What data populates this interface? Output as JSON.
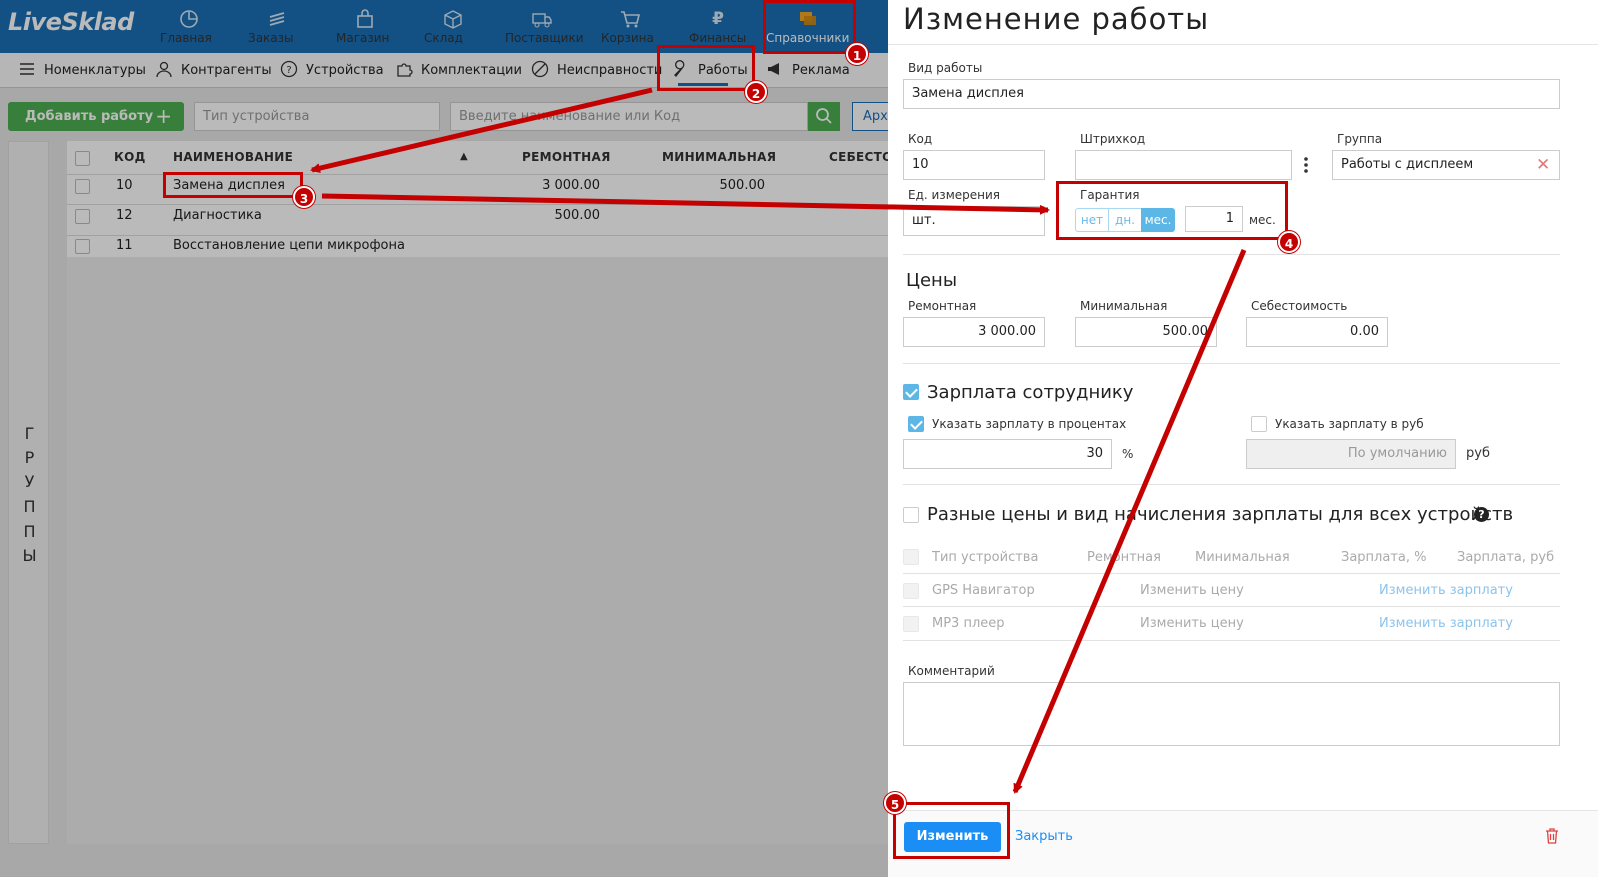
{
  "app": {
    "logo": "LiveSklad",
    "nav": [
      {
        "label": "Главная",
        "icon": "pie-chart-icon"
      },
      {
        "label": "Заказы",
        "icon": "stack-icon"
      },
      {
        "label": "Магазин",
        "icon": "shopping-bag-icon"
      },
      {
        "label": "Склад",
        "icon": "box-icon"
      },
      {
        "label": "Поставщики",
        "icon": "truck-icon"
      },
      {
        "label": "Корзина",
        "icon": "cart-icon"
      },
      {
        "label": "Финансы",
        "icon": "ruble-icon"
      },
      {
        "label": "Справочники",
        "icon": "folders-icon",
        "active": true
      }
    ],
    "subnav": [
      {
        "label": "Номенклатуры",
        "icon": "list-icon"
      },
      {
        "label": "Контрагенты",
        "icon": "users-icon"
      },
      {
        "label": "Устройства",
        "icon": "question-circle-icon"
      },
      {
        "label": "Комплектации",
        "icon": "puzzle-icon"
      },
      {
        "label": "Неисправности",
        "icon": "ban-icon"
      },
      {
        "label": "Работы",
        "icon": "wrench-icon",
        "active": true
      },
      {
        "label": "Реклама",
        "icon": "megaphone-icon"
      }
    ],
    "toolbar": {
      "add_label": "Добавить работу",
      "add_icon": "plus-icon",
      "device_placeholder": "Тип устройства",
      "search_placeholder": "Введите наименование или Код",
      "archive_label": "Арх"
    },
    "groups_label": [
      "Г",
      "Р",
      "У",
      "П",
      "П",
      "Ы"
    ],
    "table": {
      "columns": [
        "КОД",
        "НАИМЕНОВАНИЕ",
        "РЕМОНТНАЯ",
        "МИНИМАЛЬНАЯ",
        "СЕБЕСТО"
      ],
      "rows": [
        {
          "code": "10",
          "name": "Замена дисплея",
          "repair": "3 000.00",
          "min": "500.00"
        },
        {
          "code": "12",
          "name": "Диагностика",
          "repair": "500.00",
          "min": ""
        },
        {
          "code": "11",
          "name": "Восстановление цепи микрофона",
          "repair": "",
          "min": ""
        }
      ]
    }
  },
  "panel": {
    "title": "Изменение работы",
    "work_type_label": "Вид работы",
    "work_type_value": "Замена дисплея",
    "code_label": "Код",
    "code_value": "10",
    "barcode_label": "Штрихкод",
    "barcode_value": "",
    "group_label": "Группа",
    "group_value": "Работы с дисплеем",
    "unit_label": "Ед. измерения",
    "unit_value": "шт.",
    "warranty_label": "Гарантия",
    "warranty_options": [
      "нет",
      "дн.",
      "мес."
    ],
    "warranty_selected": "мес.",
    "warranty_value": "1",
    "warranty_unit": "мес.",
    "prices_title": "Цены",
    "price_repair_label": "Ремонтная",
    "price_repair_value": "3 000.00",
    "price_min_label": "Минимальная",
    "price_min_value": "500.00",
    "price_cost_label": "Себестоимость",
    "price_cost_value": "0.00",
    "salary_title": "Зарплата сотруднику",
    "salary_percent_label": "Указать зарплату в процентах",
    "salary_percent_value": "30",
    "salary_percent_unit": "%",
    "salary_rub_label": "Указать зарплату в руб",
    "salary_rub_placeholder": "По умолчанию",
    "salary_rub_unit": "руб",
    "diff_title": "Разные цены и вид начисления зарплаты для всех устройств",
    "device_table": {
      "columns": [
        "Тип устройства",
        "Ремонтная",
        "Минимальная",
        "Зарплата, %",
        "Зарплата, руб"
      ],
      "rows": [
        {
          "device": "GPS Навигатор",
          "price_link": "Изменить цену",
          "salary_link": "Изменить зарплату"
        },
        {
          "device": "MP3 плеер",
          "price_link": "Изменить цену",
          "salary_link": "Изменить зарплату"
        }
      ]
    },
    "comment_label": "Комментарий",
    "comment_value": "",
    "save_label": "Изменить",
    "close_label": "Закрыть"
  },
  "annotations": [
    "1",
    "2",
    "3",
    "4",
    "5"
  ],
  "colors": {
    "brand_blue": "#1b6fb5",
    "green": "#4caf50",
    "primary_button": "#1a8ef5",
    "annotation_red": "#c40000",
    "checkbox_blue": "#5cb6e6"
  }
}
